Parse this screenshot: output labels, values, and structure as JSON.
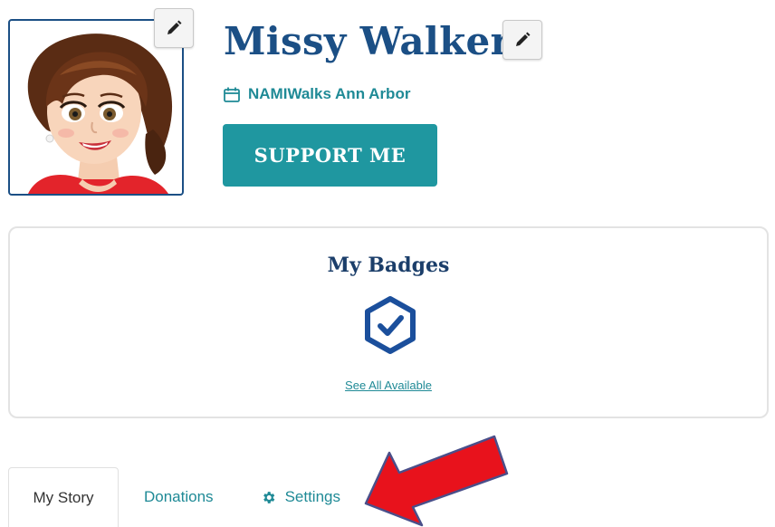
{
  "profile": {
    "name": "Missy Walker",
    "event_name": "NAMIWalks Ann Arbor",
    "support_label": "SUPPORT ME"
  },
  "badges": {
    "title": "My Badges",
    "see_all_label": "See All Available"
  },
  "tabs": [
    {
      "label": "My Story",
      "active": true
    },
    {
      "label": "Donations",
      "active": false
    },
    {
      "label": "Settings",
      "active": false,
      "icon": "gear-icon"
    }
  ],
  "icons": {
    "edit": "pencil-icon",
    "event": "calendar-icon",
    "badge": "hexagon-check-icon",
    "annotation": "red-arrow"
  },
  "colors": {
    "brand_navy": "#1b4f85",
    "accent_teal": "#1f97a0",
    "link_teal": "#1f8a96",
    "annotation_red": "#e8121c"
  }
}
